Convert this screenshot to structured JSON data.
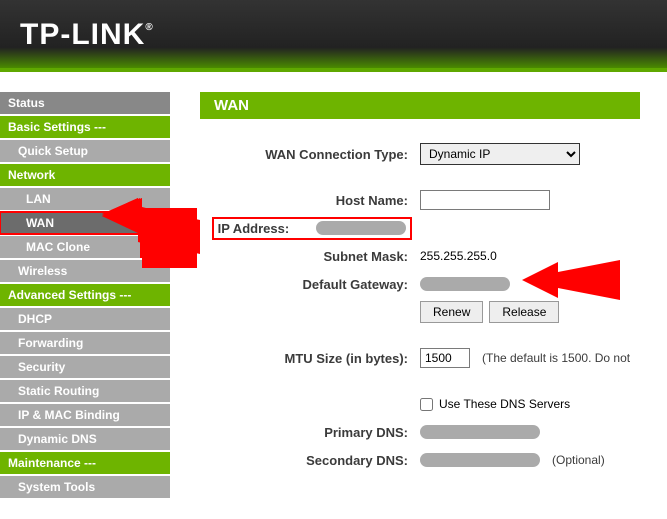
{
  "header": {
    "logo": "TP-LINK",
    "reg": "®"
  },
  "sidebar": {
    "items": [
      {
        "label": "Status",
        "cls": "menu-cat"
      },
      {
        "label": "Basic Settings ---",
        "cls": "menu-section"
      },
      {
        "label": "Quick Setup",
        "cls": "menu-sub"
      },
      {
        "label": "Network",
        "cls": "menu-section"
      },
      {
        "label": "LAN",
        "cls": "menu-sub indented"
      },
      {
        "label": "WAN",
        "cls": "menu-active"
      },
      {
        "label": "MAC Clone",
        "cls": "menu-sub indented"
      },
      {
        "label": "Wireless",
        "cls": "menu-sub"
      },
      {
        "label": "Advanced Settings ---",
        "cls": "menu-section"
      },
      {
        "label": "DHCP",
        "cls": "menu-sub"
      },
      {
        "label": "Forwarding",
        "cls": "menu-sub"
      },
      {
        "label": "Security",
        "cls": "menu-sub"
      },
      {
        "label": "Static Routing",
        "cls": "menu-sub"
      },
      {
        "label": "IP & MAC Binding",
        "cls": "menu-sub"
      },
      {
        "label": "Dynamic DNS",
        "cls": "menu-sub"
      },
      {
        "label": "Maintenance ---",
        "cls": "menu-section"
      },
      {
        "label": "System Tools",
        "cls": "menu-sub"
      }
    ]
  },
  "page": {
    "title": "WAN"
  },
  "form": {
    "conn_type_label": "WAN Connection Type:",
    "conn_type_value": "Dynamic IP",
    "host_name_label": "Host Name:",
    "host_name_value": "",
    "ip_label": "IP Address:",
    "subnet_label": "Subnet Mask:",
    "subnet_value": "255.255.255.0",
    "gateway_label": "Default Gateway:",
    "renew_label": "Renew",
    "release_label": "Release",
    "mtu_label": "MTU Size (in bytes):",
    "mtu_value": "1500",
    "mtu_hint": "(The default is 1500. Do not",
    "dns_check_label": "Use These DNS Servers",
    "primary_dns_label": "Primary DNS:",
    "secondary_dns_label": "Secondary DNS:",
    "optional_hint": "(Optional)"
  }
}
